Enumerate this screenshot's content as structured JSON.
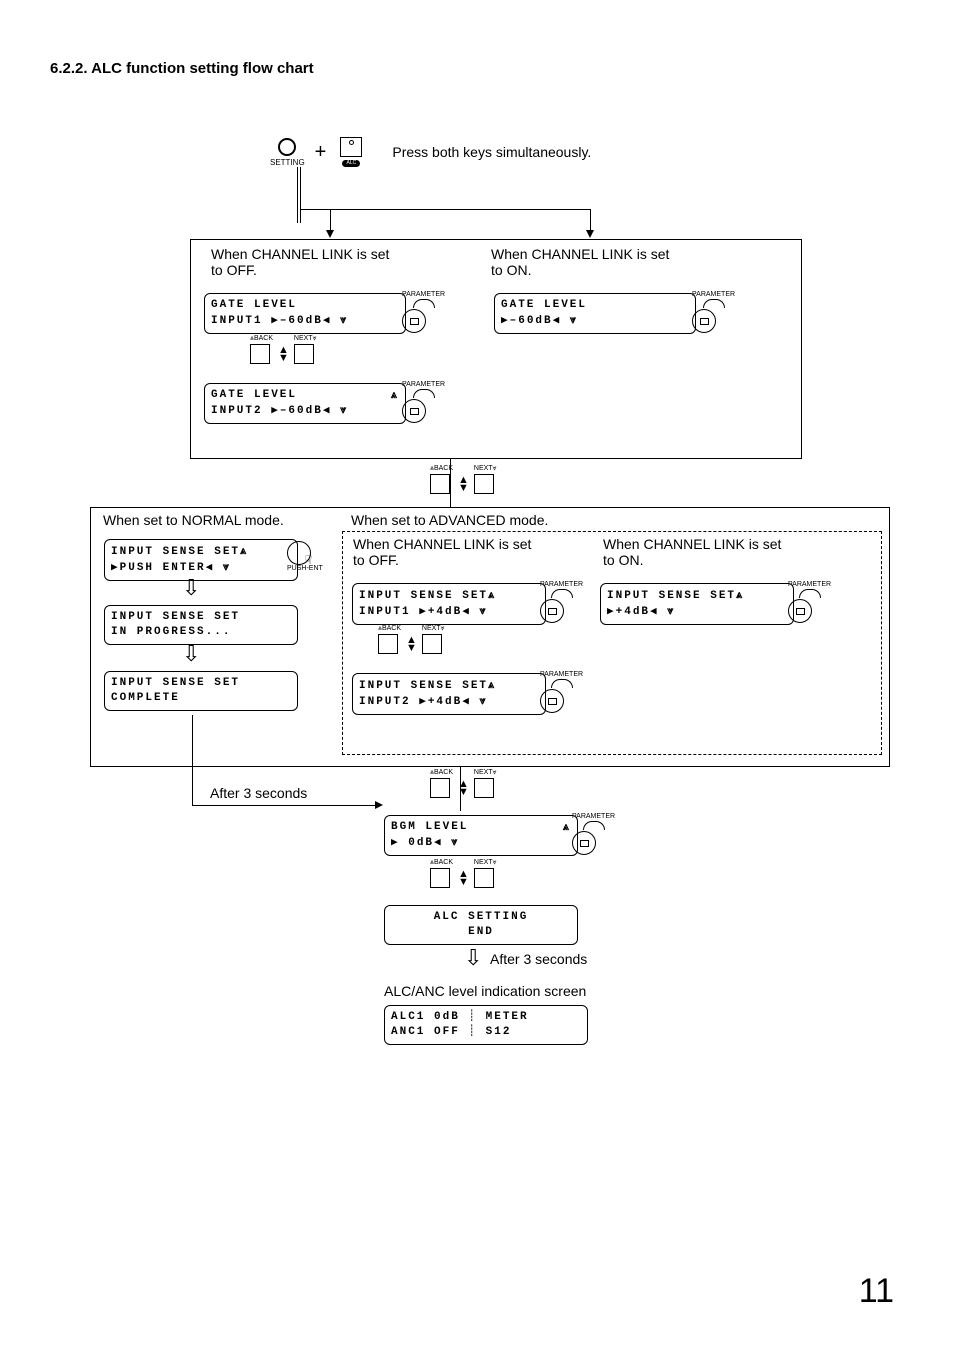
{
  "section_title": "6.2.2. ALC function setting flow chart",
  "page_number": "11",
  "keys": {
    "setting_label": "SETTING",
    "alc_label": "ALC",
    "press_both": "Press both keys simultaneously."
  },
  "labels": {
    "link_off": "When CHANNEL LINK is set to OFF.",
    "link_on": "When CHANNEL LINK is set to ON.",
    "normal": "When set to NORMAL mode.",
    "advanced": "When set to ADVANCED mode.",
    "link_off_3": "When CHANNEL LINK is set to OFF.",
    "link_on_3": "When CHANNEL LINK is set to ON.",
    "after3a": "After 3 seconds",
    "after3b": "After 3 seconds",
    "final_caption": "ALC/ANC level indication screen",
    "parameter": "PARAMETER",
    "back": "BACK",
    "next": "NEXT",
    "push_ent": "PUSH-ENT"
  },
  "lcds": {
    "gate_off": {
      "l1": "GATE LEVEL",
      "l2": "INPUT1   ▶–60dB◀ ",
      "g1": "⩓",
      "g2": "⩔"
    },
    "gate_off2": {
      "l1": "GATE LEVEL",
      "l2": "INPUT2   ▶–60dB◀ ",
      "g1": "⩓",
      "g2": "⩔"
    },
    "gate_on": {
      "l1": "GATE LEVEL",
      "l2": "         ▶–60dB◀ ",
      "g2": "⩔"
    },
    "sense_norm1": {
      "l1": "INPUT SENSE SET",
      "l2": "▶PUSH ENTER◀  ",
      "g1": "⩓",
      "g2": "⩔"
    },
    "sense_norm2": {
      "l1": "INPUT SENSE SET",
      "l2": "IN PROGRESS..."
    },
    "sense_norm3": {
      "l1": "INPUT SENSE SET",
      "l2": "  COMPLETE"
    },
    "sense_adv_off1": {
      "l1": "INPUT SENSE SET",
      "l2": "INPUT1    ▶+4dB◀ ",
      "g1": "⩓",
      "g2": "⩔"
    },
    "sense_adv_off2": {
      "l1": "INPUT SENSE SET",
      "l2": "INPUT2    ▶+4dB◀ ",
      "g1": "⩓",
      "g2": "⩔"
    },
    "sense_adv_on": {
      "l1": "INPUT SENSE SET",
      "l2": "          ▶+4dB◀ ",
      "g1": "⩓",
      "g2": "⩔"
    },
    "bgm": {
      "l1": "BGM LEVEL",
      "l2": "        ▶ 0dB◀ ",
      "g1": "⩓",
      "g2": "⩔"
    },
    "end": {
      "l1": "ALC SETTING",
      "l2": "    END"
    },
    "final": {
      "l1": "ALC1  0dB ┊ METER",
      "l2": "ANC1  OFF ┊  S12"
    }
  }
}
